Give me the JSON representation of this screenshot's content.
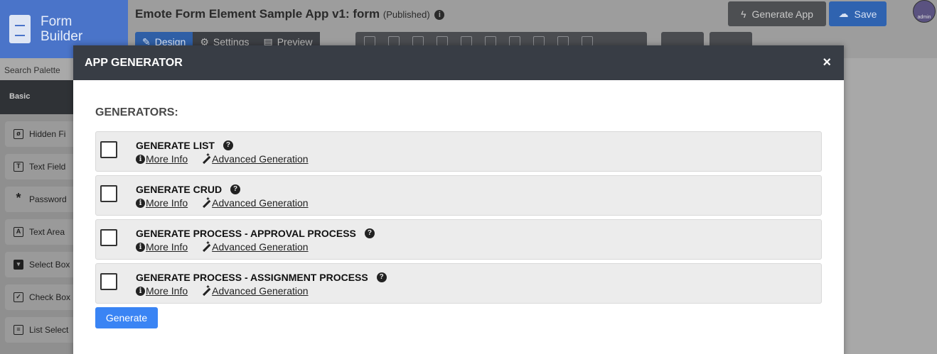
{
  "brand": {
    "line1": "Form",
    "line2": "Builder"
  },
  "header": {
    "title": "Emote Form Element Sample App v1: form",
    "status": "(Published)",
    "generate_app_label": "Generate App",
    "save_label": "Save",
    "avatar_text": "admin"
  },
  "tabs": [
    {
      "label": "Design"
    },
    {
      "label": "Settings"
    },
    {
      "label": "Preview"
    }
  ],
  "palette": {
    "search_placeholder": "Search Palette",
    "category": "Basic",
    "items": [
      {
        "label": "Hidden Fi",
        "icon": "eye-slash-icon"
      },
      {
        "label": "Text Field",
        "icon": "text-field-icon"
      },
      {
        "label": "Password",
        "icon": "asterisk-icon"
      },
      {
        "label": "Text Area",
        "icon": "text-area-icon"
      },
      {
        "label": "Select Box",
        "icon": "select-box-icon"
      },
      {
        "label": "Check Box",
        "icon": "check-box-icon"
      },
      {
        "label": "List Select",
        "icon": "list-icon"
      }
    ]
  },
  "modal": {
    "title": "APP GENERATOR",
    "close": "×",
    "section_title": "GENERATORS:",
    "more_info_label": "More Info",
    "advanced_label": "Advanced Generation",
    "generators": [
      {
        "name": "GENERATE LIST",
        "checked": false
      },
      {
        "name": "GENERATE CRUD",
        "checked": false
      },
      {
        "name": "GENERATE PROCESS - APPROVAL PROCESS",
        "checked": false
      },
      {
        "name": "GENERATE PROCESS - ASSIGNMENT PROCESS",
        "checked": false
      }
    ],
    "generate_button": "Generate"
  },
  "colors": {
    "modal_header": "#383d45",
    "primary_button": "#3a84f4",
    "generator_row": "#ececec",
    "brand": "#4a74c9"
  }
}
